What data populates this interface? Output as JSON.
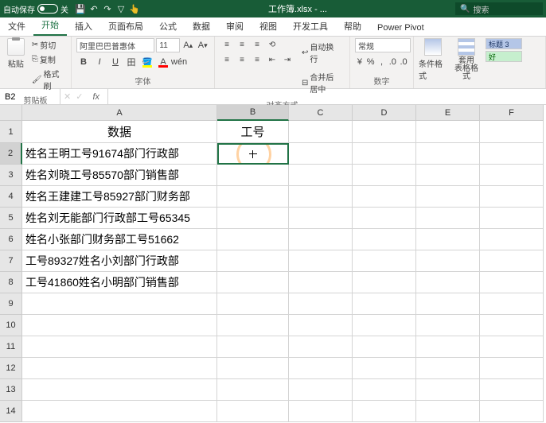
{
  "titlebar": {
    "autosave": "自动保存",
    "off": "关",
    "title": "工作簿.xlsx - ...",
    "search": "搜索"
  },
  "tabs": [
    "文件",
    "开始",
    "插入",
    "页面布局",
    "公式",
    "数据",
    "审阅",
    "视图",
    "开发工具",
    "帮助",
    "Power Pivot"
  ],
  "active_tab": 1,
  "ribbon": {
    "clipboard": {
      "label": "剪贴板",
      "paste": "粘贴",
      "cut": "剪切",
      "copy": "复制",
      "brush": "格式刷"
    },
    "font": {
      "label": "字体",
      "name": "阿里巴巴普惠体",
      "size": "11"
    },
    "align": {
      "label": "对齐方式",
      "wrap": "自动换行",
      "merge": "合并后居中"
    },
    "number": {
      "label": "数字",
      "format": "常规"
    },
    "styles": {
      "cond": "条件格式",
      "table": "套用\n表格格式",
      "title": "标题 3",
      "good": "好"
    }
  },
  "namebox": "B2",
  "cols": [
    "A",
    "B",
    "C",
    "D",
    "E",
    "F"
  ],
  "rows": [
    "1",
    "2",
    "3",
    "4",
    "5",
    "6",
    "7",
    "8",
    "9",
    "10",
    "11",
    "12",
    "13",
    "14"
  ],
  "data": {
    "A1": "数据",
    "B1": "工号",
    "A2": "姓名王明工号91674部门行政部",
    "A3": "姓名刘晓工号85570部门销售部",
    "A4": "姓名王建建工号85927部门财务部",
    "A5": "姓名刘无能部门行政部工号65345",
    "A6": "姓名小张部门财务部工号51662",
    "A7": "工号89327姓名小刘部门行政部",
    "A8": "工号41860姓名小明部门销售部"
  }
}
